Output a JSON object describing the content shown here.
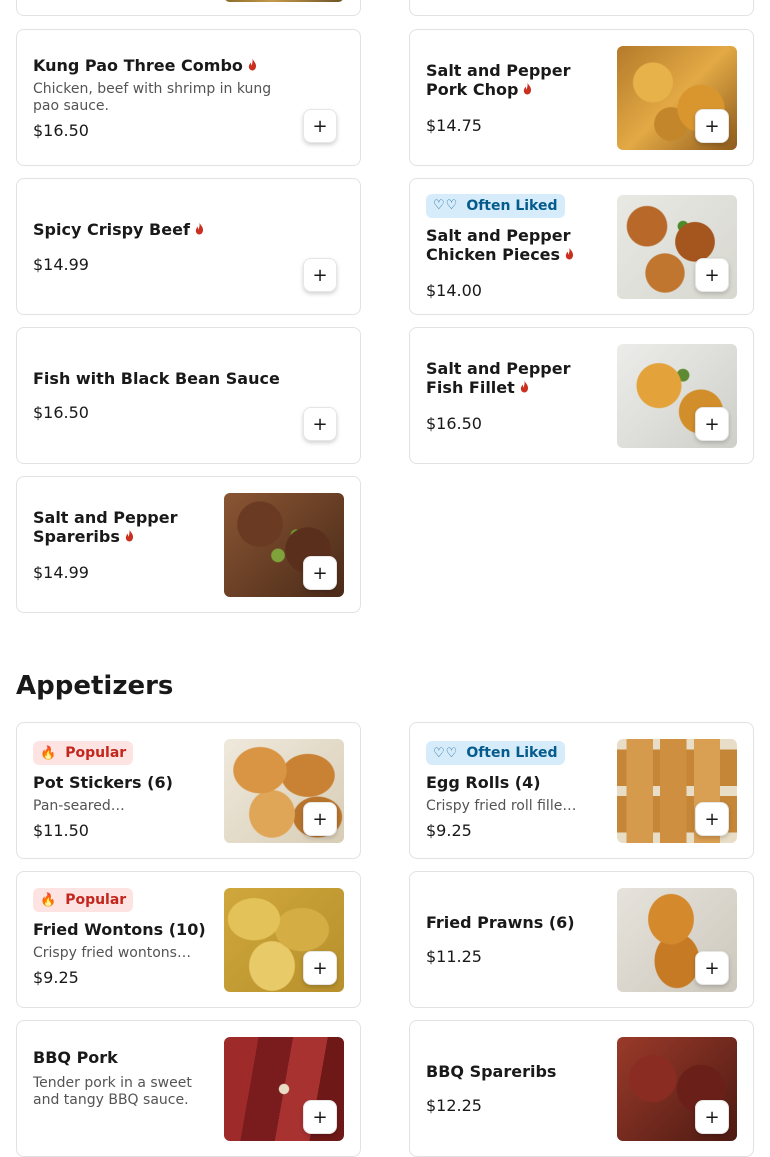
{
  "top_row": [
    {
      "name": "Kung Pao Three Combo",
      "spicy": true,
      "description": "Chicken, beef with shrimp in kung pao sauce.",
      "price": "$16.50",
      "image": null
    },
    {
      "name": "Salt and Pepper Pork Chop",
      "spicy": true,
      "description": "",
      "price": "$14.75",
      "image": "fried-pork-chop"
    }
  ],
  "combo_menu": {
    "left": [
      {
        "name": "Spicy Crispy Beef",
        "spicy": true,
        "price": "$14.99"
      },
      {
        "name": "Fish with Black Bean Sauce",
        "spicy": false,
        "price": "$16.50"
      },
      {
        "name": "Salt and Pepper Spareribs",
        "spicy": true,
        "price": "$14.99",
        "image": "spareribs-with-peppers"
      }
    ],
    "right": [
      {
        "badge": "Often Liked",
        "name": "Salt and Pepper Chicken Pieces",
        "spicy": true,
        "price": "$14.00",
        "image": "fried-chicken-pieces"
      },
      {
        "name": "Salt and Pepper Fish Fillet",
        "spicy": true,
        "price": "$16.50",
        "image": "fried-fish-fillet"
      }
    ]
  },
  "appetizers": {
    "title": "Appetizers",
    "items": [
      {
        "badge": "Popular",
        "name": "Pot Stickers (6)",
        "description": "Pan-seared…",
        "price": "$11.50",
        "image": "pot-stickers"
      },
      {
        "badge": "Often Liked",
        "name": "Egg Rolls (4)",
        "description": "Crispy fried roll fille…",
        "price": "$9.25",
        "image": "egg-rolls"
      },
      {
        "badge": "Popular",
        "name": "Fried Wontons (10)",
        "description": "Crispy fried wontons…",
        "price": "$9.25",
        "image": "fried-wontons"
      },
      {
        "name": "Fried Prawns (6)",
        "description": "",
        "price": "$11.25",
        "image": "fried-prawns"
      },
      {
        "name": "BBQ Pork",
        "description": "Tender pork in a sweet and tangy BBQ sauce.",
        "price": "",
        "image": "bbq-pork"
      },
      {
        "name": "BBQ Spareribs",
        "description": "",
        "price": "$12.25",
        "image": "bbq-spareribs"
      }
    ]
  },
  "add_button_label": "+",
  "icons": {
    "spicy": "flame-icon",
    "popular": "fire-icon",
    "often_liked": "heart-icon"
  },
  "colors": {
    "spicy": "#c9301f",
    "popular_bg": "#fde3e2",
    "popular_text": "#c2261c",
    "often_bg": "#d6ecfb",
    "often_text": "#045b8c"
  }
}
